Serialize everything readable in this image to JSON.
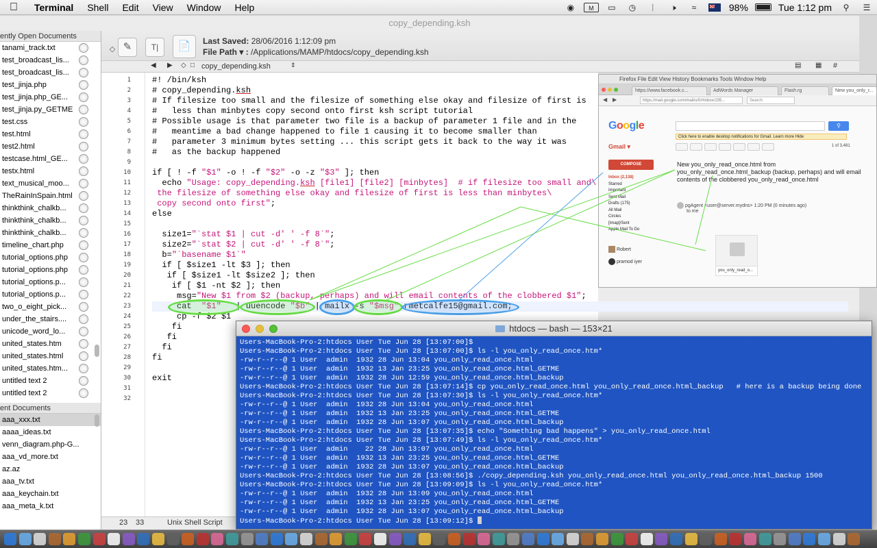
{
  "menubar": {
    "app": "Terminal",
    "items": [
      "Shell",
      "Edit",
      "View",
      "Window",
      "Help"
    ],
    "battery": "98%",
    "clock": "Tue 1:12 pm"
  },
  "editor": {
    "window_title": "copy_depending.ksh",
    "last_saved_label": "Last Saved:",
    "last_saved_value": "28/06/2016 1:12:09 pm",
    "file_path_label": "File Path ▾ :",
    "file_path_value": "/Applications/MAMP/htdocs/copy_depending.ksh",
    "tab_name": "copy_depending.ksh",
    "status_line": "23",
    "status_col": "33",
    "status_lang": "Unix Shell Script"
  },
  "sidebar": {
    "recent_header": "ently Open Documents",
    "recent_items": [
      "tanami_track.txt",
      "test_broadcast_lis...",
      "test_broadcast_lis...",
      "test_jinja.php",
      "test_jinja.php_GE...",
      "test_jinja.py_GETME",
      "test.css",
      "test.html",
      "test2.html",
      "testcase.html_GE...",
      "testx.html",
      "text_musical_moo...",
      "TheRainInSpain.html",
      "thinkthink_chalkb...",
      "thinkthink_chalkb...",
      "thinkthink_chalkb...",
      "timeline_chart.php",
      "tutorial_options.php",
      "tutorial_options.php",
      "tutorial_options.p...",
      "tutorial_options.p...",
      "two_o_eight_pick...",
      "under_the_stairs....",
      "unicode_word_lo...",
      "united_states.htm",
      "united_states.html",
      "united_states.htm...",
      "untitled text 2",
      "untitled text 2"
    ],
    "second_header": "ent Documents",
    "second_items": [
      "aaa_xxx.txt",
      "aaaa_ideas.txt",
      "venn_diagram.php-G...",
      "aaa_vd_more.txt",
      "az.az",
      "aaa_tv.txt",
      "aaa_keychain.txt",
      "aaa_meta_k.txt"
    ]
  },
  "code": {
    "line_numbers": [
      "1",
      "2",
      "3",
      "4",
      "5",
      "6",
      "7",
      "8",
      "9",
      "10",
      "11",
      "12",
      "13",
      "14",
      "15",
      "16",
      "17",
      "18",
      "19",
      "20",
      "21",
      "22",
      "23",
      "24",
      "25",
      "26",
      "27",
      "28",
      "29",
      "30",
      "31",
      "32"
    ],
    "l1": "#! /bin/ksh",
    "l2a": "# copy_depending.",
    "l2b": "ksh",
    "l3": "# If filesize too small and the filesize of something else okay and filesize of first is",
    "l4": "#   less than minbytes copy second onto first ksh script tutorial",
    "l5": "# Possible usage is that parameter two file is a backup of parameter 1 file and in the",
    "l6": "#   meantime a bad change happened to file 1 causing it to become smaller than",
    "l7": "#   parameter 3 minimum bytes setting ... this script gets it back to the way it was",
    "l8": "#   as the backup happened",
    "l10a": "if [ ! -f ",
    "l10b": "\"$1\"",
    "l10c": " -o ! -f ",
    "l10d": "\"$2\"",
    "l10e": " -o -z ",
    "l10f": "\"$3\"",
    "l10g": " ]; then",
    "l11a": "  echo ",
    "l11b": "\"Usage: copy_depending.",
    "l11c": "ksh",
    "l11d": " [file1] [file2] [minbytes]  # if filesize too small and\\",
    "l12": " the filesize of something else okay and filesize of first is less than minbytes\\",
    "l13": " copy second onto first\"",
    "l13b": ";",
    "l14": "else",
    "l16a": "  size1=",
    "l16b": "\"`stat $1 | cut -d' ' -f 8`\"",
    "l16c": ";",
    "l17a": "  size2=",
    "l17b": "\"`stat $2 | cut -d' ' -f 8`\"",
    "l17c": ";",
    "l18a": "  b=",
    "l18b": "\"`basename $1`\"",
    "l19": "  if [ $size1 -lt $3 ]; then",
    "l20": "   if [ $size1 -lt $size2 ]; then",
    "l21": "    if [ $1 -nt $2 ]; then",
    "l22a": "     msg=",
    "l22b": "\"New $1 from $2 (backup, perhaps) and will email contents of the clobbered $1\"",
    "l22c": ";",
    "l23a": "     cat  ",
    "l23b": "\"$1\"",
    "l23c": "   | uuencode ",
    "l23d": "\"$b\"",
    "l23e": " | mailx -s ",
    "l23f": "\"$msg\"",
    "l23g": " rmetcalfe15@gmail.com;",
    "l24": "     cp -f $2 $1",
    "l25": "    fi",
    "l26": "   fi",
    "l27": "  fi",
    "l28": "fi",
    "l30": "exit"
  },
  "browser": {
    "menu": "Firefox   File   Edit   View   History   Bookmarks   Tools   Window   Help",
    "tabs": [
      "https://www.facebook.c...",
      "AdWords Manager",
      "Flash.rg",
      "New you_only_r..."
    ],
    "url": "https://mail.google.com/mail/u/0/#inbox/155...",
    "search_placeholder": "Search",
    "logo": "Google",
    "search_button": "Search",
    "notice": "Click here to enable desktop notifications for Gmail.  Learn more  Hide",
    "gmail": "Gmail ▾",
    "compose": "COMPOSE",
    "nav": [
      "Inbox (2,138)",
      "Starred",
      "Important",
      "Sent Mail",
      "Drafts (175)",
      "All Mail",
      "Circles",
      "[Imap]/Sent",
      "Apple Mail To Do"
    ],
    "subject": "New you_only_read_once.html from you_only_read_once.html_backup (backup, perhaps) and will email contents of the clobbered you_only_read_once.html",
    "sender": "pgAgent <user@server.mydns>    1:20 PM (0 minutes ago)",
    "to": "to me",
    "attachment": "you_only_read_o...",
    "chat_name": "Robert",
    "chat_user": "pramod iyer",
    "count": "1 of 3,481"
  },
  "terminal": {
    "title": "htdocs — bash — 153×21",
    "lines": [
      "Users-MacBook-Pro-2:htdocs User Tue Jun 28 [13:07:00]$",
      "Users-MacBook-Pro-2:htdocs User Tue Jun 28 [13:07:00]$ ls -l you_only_read_once.htm*",
      "-rw-r--r--@ 1 User  admin  1932 28 Jun 13:04 you_only_read_once.html",
      "-rw-r--r--@ 1 User  admin  1932 13 Jan 23:25 you_only_read_once.html_GETME",
      "-rw-r--r--@ 1 User  admin  1932 28 Jun 12:59 you_only_read_once.html_backup",
      "Users-MacBook-Pro-2:htdocs User Tue Jun 28 [13:07:14]$ cp you_only_read_once.html you_only_read_once.html_backup   # here is a backup being done",
      "Users-MacBook-Pro-2:htdocs User Tue Jun 28 [13:07:30]$ ls -l you_only_read_once.htm*",
      "-rw-r--r--@ 1 User  admin  1932 28 Jun 13:04 you_only_read_once.html",
      "-rw-r--r--@ 1 User  admin  1932 13 Jan 23:25 you_only_read_once.html_GETME",
      "-rw-r--r--@ 1 User  admin  1932 28 Jun 13:07 you_only_read_once.html_backup",
      "Users-MacBook-Pro-2:htdocs User Tue Jun 28 [13:07:35]$ echo \"Something bad happens\" > you_only_read_once.html",
      "Users-MacBook-Pro-2:htdocs User Tue Jun 28 [13:07:49]$ ls -l you_only_read_once.htm*",
      "-rw-r--r--@ 1 User  admin    22 28 Jun 13:07 you_only_read_once.html",
      "-rw-r--r--@ 1 User  admin  1932 13 Jan 23:25 you_only_read_once.html_GETME",
      "-rw-r--r--@ 1 User  admin  1932 28 Jun 13:07 you_only_read_once.html_backup",
      "Users-MacBook-Pro-2:htdocs User Tue Jun 28 [13:08:56]$ ./copy_depending.ksh you_only_read_once.html you_only_read_once.html_backup 1500",
      "Users-MacBook-Pro-2:htdocs User Tue Jun 28 [13:09:09]$ ls -l you_only_read_once.htm*",
      "-rw-r--r--@ 1 User  admin  1932 28 Jun 13:09 you_only_read_once.html",
      "-rw-r--r--@ 1 User  admin  1932 13 Jan 23:25 you_only_read_once.html_GETME",
      "-rw-r--r--@ 1 User  admin  1932 28 Jun 13:07 you_only_read_once.html_backup"
    ],
    "prompt": "Users-MacBook-Pro-2:htdocs User Tue Jun 28 [13:09:12]$ "
  }
}
